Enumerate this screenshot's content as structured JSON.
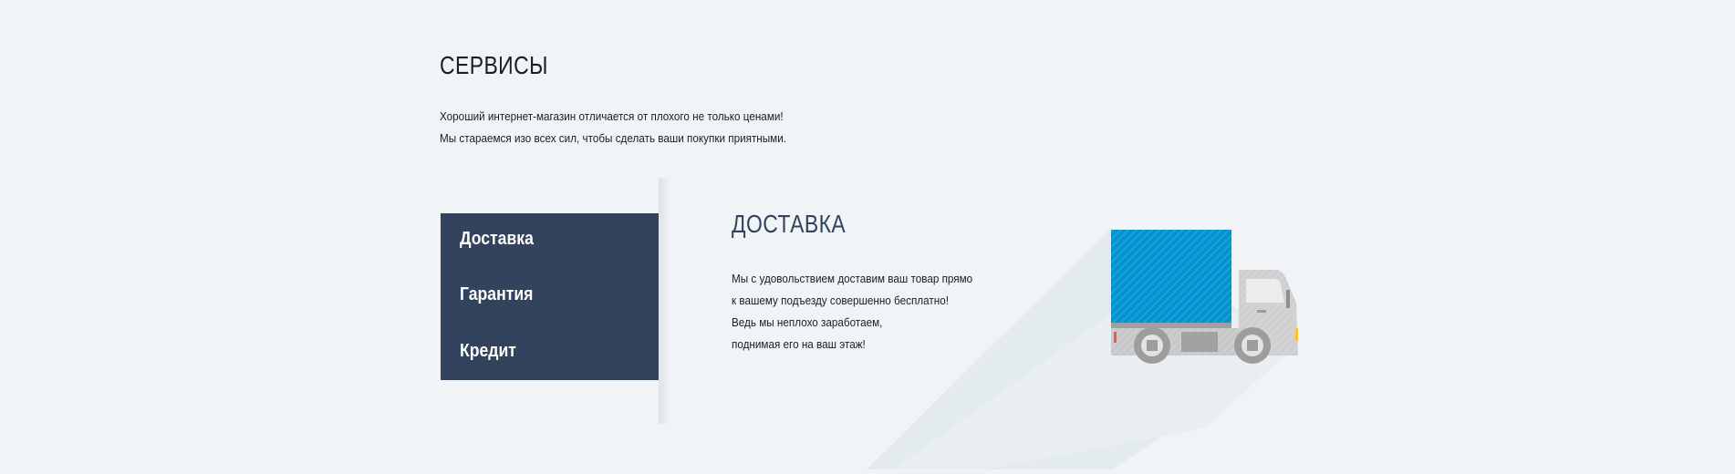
{
  "services": {
    "title": "СЕРВИСЫ",
    "intro": [
      "Хороший интернет-магазин отличается от плохого не только ценами!",
      "Мы стараемся изо всех сил, чтобы сделать ваши покупки приятными."
    ]
  },
  "menu": {
    "items": [
      {
        "label": "Доставка"
      },
      {
        "label": "Гарантия"
      },
      {
        "label": "Кредит"
      }
    ]
  },
  "panel": {
    "title": "ДОСТАВКА",
    "lines": [
      "Мы с удовольствием доставим ваш товар прямо",
      "к вашему подъезду совершенно бесплатно!",
      "Ведь мы неплохо заработаем,",
      "поднимая его на ваш этаж!"
    ],
    "illustration": "delivery-truck-icon"
  },
  "colors": {
    "background": "#f0f4f7",
    "menu_bg": "#33435d",
    "title_accent": "#33435d",
    "truck_cargo": "#0093d1",
    "truck_cab": "#c9c9c9"
  }
}
